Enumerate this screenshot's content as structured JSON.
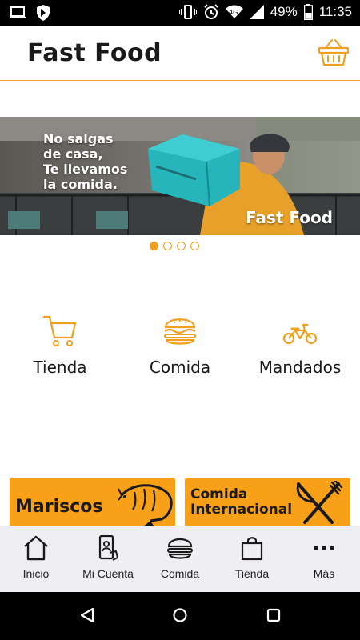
{
  "status_bar": {
    "battery": "49%",
    "time": "11:35",
    "icons": [
      "laptop-icon",
      "shield-icon",
      "vibrate-icon",
      "alarm-icon",
      "wifi-icon",
      "signal-icon",
      "battery-icon"
    ]
  },
  "header": {
    "title": "Fast Food",
    "cart_icon": "basket-icon"
  },
  "banner": {
    "text": "No salgas\nde casa,\nTe llevamos\nla comida.",
    "brand": "Fast Food",
    "slide_count": 4,
    "active_slide": 1
  },
  "categories": [
    {
      "label": "Tienda",
      "icon": "shopping-cart-icon"
    },
    {
      "label": "Comida",
      "icon": "burger-icon"
    },
    {
      "label": "Mandados",
      "icon": "motorcycle-icon"
    }
  ],
  "cards": [
    {
      "label": "Mariscos",
      "icon": "shrimp-icon"
    },
    {
      "label": "Comida\nInternacional",
      "icon": "fork-knife-icon"
    }
  ],
  "bottom_nav": [
    {
      "label": "Inicio",
      "icon": "home-icon"
    },
    {
      "label": "Mi Cuenta",
      "icon": "account-phone-icon"
    },
    {
      "label": "Comida",
      "icon": "burger-icon"
    },
    {
      "label": "Tienda",
      "icon": "shopping-bag-icon"
    },
    {
      "label": "Más",
      "icon": "more-dots-icon"
    }
  ],
  "colors": {
    "accent": "#f0a020",
    "card": "#f8a018",
    "nav_bg": "#efeef2",
    "text": "#1a1a1a"
  }
}
